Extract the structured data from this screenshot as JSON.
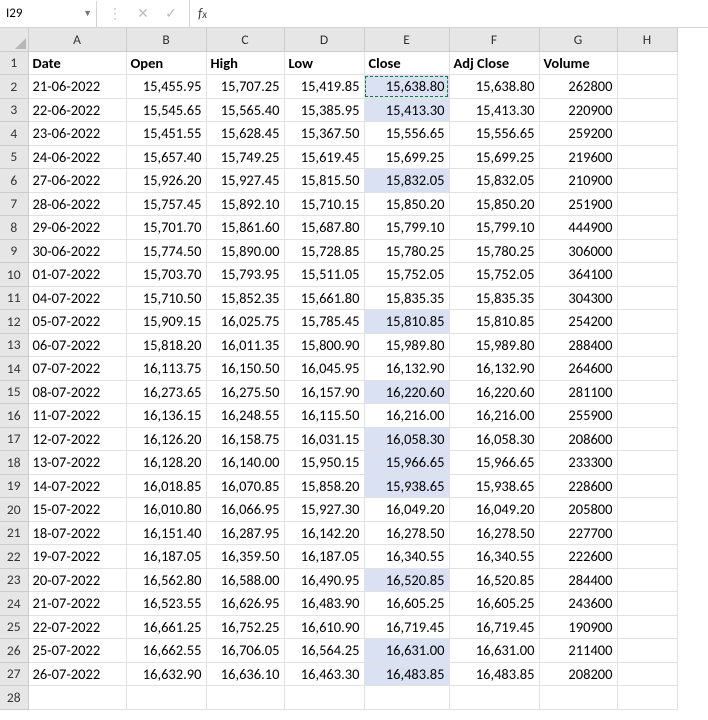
{
  "nameBox": "I29",
  "fxValue": "",
  "columns": [
    "A",
    "B",
    "C",
    "D",
    "E",
    "F",
    "G",
    "H"
  ],
  "headers": [
    "Date",
    "Open",
    "High",
    "Low",
    "Close",
    "Adj Close",
    "Volume"
  ],
  "highlightedCells": [
    "E2",
    "E3",
    "E6",
    "E12",
    "E15",
    "E17",
    "E18",
    "E19",
    "E23",
    "E26",
    "E27"
  ],
  "copyOutlineCell": "E2",
  "rows": [
    {
      "n": 1,
      "date": "Date",
      "open": "Open",
      "high": "High",
      "low": "Low",
      "close": "Close",
      "adj": "Adj Close",
      "vol": "Volume",
      "header": true
    },
    {
      "n": 2,
      "date": "21-06-2022",
      "open": "15,455.95",
      "high": "15,707.25",
      "low": "15,419.85",
      "close": "15,638.80",
      "adj": "15,638.80",
      "vol": "262800"
    },
    {
      "n": 3,
      "date": "22-06-2022",
      "open": "15,545.65",
      "high": "15,565.40",
      "low": "15,385.95",
      "close": "15,413.30",
      "adj": "15,413.30",
      "vol": "220900"
    },
    {
      "n": 4,
      "date": "23-06-2022",
      "open": "15,451.55",
      "high": "15,628.45",
      "low": "15,367.50",
      "close": "15,556.65",
      "adj": "15,556.65",
      "vol": "259200"
    },
    {
      "n": 5,
      "date": "24-06-2022",
      "open": "15,657.40",
      "high": "15,749.25",
      "low": "15,619.45",
      "close": "15,699.25",
      "adj": "15,699.25",
      "vol": "219600"
    },
    {
      "n": 6,
      "date": "27-06-2022",
      "open": "15,926.20",
      "high": "15,927.45",
      "low": "15,815.50",
      "close": "15,832.05",
      "adj": "15,832.05",
      "vol": "210900"
    },
    {
      "n": 7,
      "date": "28-06-2022",
      "open": "15,757.45",
      "high": "15,892.10",
      "low": "15,710.15",
      "close": "15,850.20",
      "adj": "15,850.20",
      "vol": "251900"
    },
    {
      "n": 8,
      "date": "29-06-2022",
      "open": "15,701.70",
      "high": "15,861.60",
      "low": "15,687.80",
      "close": "15,799.10",
      "adj": "15,799.10",
      "vol": "444900"
    },
    {
      "n": 9,
      "date": "30-06-2022",
      "open": "15,774.50",
      "high": "15,890.00",
      "low": "15,728.85",
      "close": "15,780.25",
      "adj": "15,780.25",
      "vol": "306000"
    },
    {
      "n": 10,
      "date": "01-07-2022",
      "open": "15,703.70",
      "high": "15,793.95",
      "low": "15,511.05",
      "close": "15,752.05",
      "adj": "15,752.05",
      "vol": "364100"
    },
    {
      "n": 11,
      "date": "04-07-2022",
      "open": "15,710.50",
      "high": "15,852.35",
      "low": "15,661.80",
      "close": "15,835.35",
      "adj": "15,835.35",
      "vol": "304300"
    },
    {
      "n": 12,
      "date": "05-07-2022",
      "open": "15,909.15",
      "high": "16,025.75",
      "low": "15,785.45",
      "close": "15,810.85",
      "adj": "15,810.85",
      "vol": "254200"
    },
    {
      "n": 13,
      "date": "06-07-2022",
      "open": "15,818.20",
      "high": "16,011.35",
      "low": "15,800.90",
      "close": "15,989.80",
      "adj": "15,989.80",
      "vol": "288400"
    },
    {
      "n": 14,
      "date": "07-07-2022",
      "open": "16,113.75",
      "high": "16,150.50",
      "low": "16,045.95",
      "close": "16,132.90",
      "adj": "16,132.90",
      "vol": "264600"
    },
    {
      "n": 15,
      "date": "08-07-2022",
      "open": "16,273.65",
      "high": "16,275.50",
      "low": "16,157.90",
      "close": "16,220.60",
      "adj": "16,220.60",
      "vol": "281100"
    },
    {
      "n": 16,
      "date": "11-07-2022",
      "open": "16,136.15",
      "high": "16,248.55",
      "low": "16,115.50",
      "close": "16,216.00",
      "adj": "16,216.00",
      "vol": "255900"
    },
    {
      "n": 17,
      "date": "12-07-2022",
      "open": "16,126.20",
      "high": "16,158.75",
      "low": "16,031.15",
      "close": "16,058.30",
      "adj": "16,058.30",
      "vol": "208600"
    },
    {
      "n": 18,
      "date": "13-07-2022",
      "open": "16,128.20",
      "high": "16,140.00",
      "low": "15,950.15",
      "close": "15,966.65",
      "adj": "15,966.65",
      "vol": "233300"
    },
    {
      "n": 19,
      "date": "14-07-2022",
      "open": "16,018.85",
      "high": "16,070.85",
      "low": "15,858.20",
      "close": "15,938.65",
      "adj": "15,938.65",
      "vol": "228600"
    },
    {
      "n": 20,
      "date": "15-07-2022",
      "open": "16,010.80",
      "high": "16,066.95",
      "low": "15,927.30",
      "close": "16,049.20",
      "adj": "16,049.20",
      "vol": "205800"
    },
    {
      "n": 21,
      "date": "18-07-2022",
      "open": "16,151.40",
      "high": "16,287.95",
      "low": "16,142.20",
      "close": "16,278.50",
      "adj": "16,278.50",
      "vol": "227700"
    },
    {
      "n": 22,
      "date": "19-07-2022",
      "open": "16,187.05",
      "high": "16,359.50",
      "low": "16,187.05",
      "close": "16,340.55",
      "adj": "16,340.55",
      "vol": "222600"
    },
    {
      "n": 23,
      "date": "20-07-2022",
      "open": "16,562.80",
      "high": "16,588.00",
      "low": "16,490.95",
      "close": "16,520.85",
      "adj": "16,520.85",
      "vol": "284400"
    },
    {
      "n": 24,
      "date": "21-07-2022",
      "open": "16,523.55",
      "high": "16,626.95",
      "low": "16,483.90",
      "close": "16,605.25",
      "adj": "16,605.25",
      "vol": "243600"
    },
    {
      "n": 25,
      "date": "22-07-2022",
      "open": "16,661.25",
      "high": "16,752.25",
      "low": "16,610.90",
      "close": "16,719.45",
      "adj": "16,719.45",
      "vol": "190900"
    },
    {
      "n": 26,
      "date": "25-07-2022",
      "open": "16,662.55",
      "high": "16,706.05",
      "low": "16,564.25",
      "close": "16,631.00",
      "adj": "16,631.00",
      "vol": "211400"
    },
    {
      "n": 27,
      "date": "26-07-2022",
      "open": "16,632.90",
      "high": "16,636.10",
      "low": "16,463.30",
      "close": "16,483.85",
      "adj": "16,483.85",
      "vol": "208200"
    },
    {
      "n": 28,
      "date": "",
      "open": "",
      "high": "",
      "low": "",
      "close": "",
      "adj": "",
      "vol": ""
    }
  ]
}
